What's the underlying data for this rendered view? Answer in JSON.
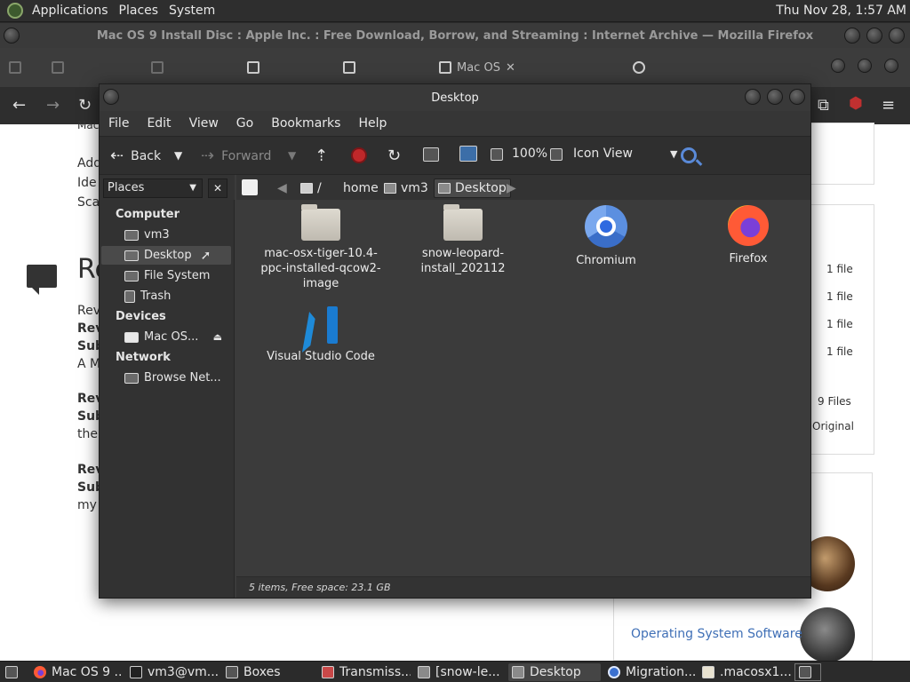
{
  "top_panel": {
    "menus": [
      "Applications",
      "Places",
      "System"
    ],
    "clock": "Thu Nov 28,  1:57 AM"
  },
  "firefox": {
    "title": "Mac OS 9 Install Disc : Apple Inc. : Free Download, Borrow, and Streaming : Internet Archive — Mozilla Firefox",
    "active_tab": "Mac OS",
    "page": {
      "lines": [
        "Mac",
        "Add",
        "Ide",
        "Sca",
        "Re",
        "Rev",
        "Rev",
        "Sub",
        "A M",
        "Rev",
        "Sub",
        "the",
        "Rev",
        "Sub",
        "my"
      ],
      "file_counts": [
        "1 file",
        "1 file",
        "1 file",
        "1 file"
      ],
      "files_total": "9 Files",
      "original": "Original",
      "link": "Operating System Software"
    }
  },
  "file_manager": {
    "title": "Desktop",
    "menu": [
      "File",
      "Edit",
      "View",
      "Go",
      "Bookmarks",
      "Help"
    ],
    "toolbar": {
      "back": "Back",
      "forward": "Forward",
      "zoom": "100%",
      "view_mode": "Icon View"
    },
    "sidebar": {
      "selector": "Places",
      "sections": [
        {
          "title": "Computer",
          "items": [
            "vm3",
            "Desktop",
            "File System",
            "Trash"
          ]
        },
        {
          "title": "Devices",
          "items": [
            "Mac OS..."
          ]
        },
        {
          "title": "Network",
          "items": [
            "Browse Net..."
          ]
        }
      ],
      "active_item": "Desktop"
    },
    "location": {
      "separator": "/",
      "crumbs": [
        "home",
        "vm3",
        "Desktop"
      ]
    },
    "items": [
      {
        "label": "mac-osx-tiger-10.4-ppc-installed-qcow2-image",
        "kind": "folder"
      },
      {
        "label": "snow-leopard-install_202112",
        "kind": "folder"
      },
      {
        "label": "Chromium",
        "kind": "chromium"
      },
      {
        "label": "Firefox",
        "kind": "firefox"
      },
      {
        "label": "Visual Studio Code",
        "kind": "vscode"
      }
    ],
    "status": "5 items, Free space: 23.1 GB"
  },
  "taskbar": {
    "tasks": [
      "Mac OS 9 ...",
      "vm3@vm...",
      "Boxes",
      "Transmiss...",
      "[snow-le...",
      "Desktop",
      "Migration...",
      ".macosx1..."
    ],
    "active_task": "Desktop"
  }
}
